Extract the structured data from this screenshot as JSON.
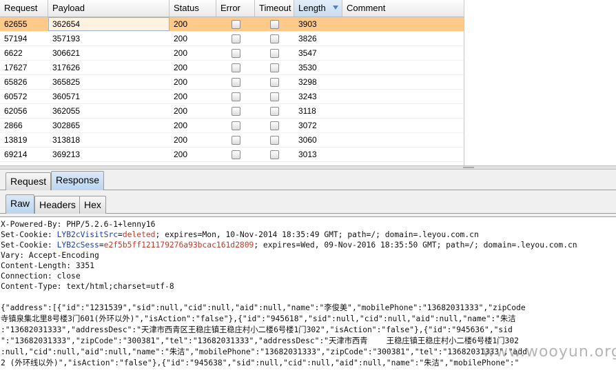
{
  "table": {
    "columns": [
      "Request",
      "Payload",
      "Status",
      "Error",
      "Timeout",
      "Length",
      "Comment"
    ],
    "rows": [
      {
        "request": "62655",
        "payload": "362654",
        "status": "200",
        "length": "3903"
      },
      {
        "request": "57194",
        "payload": "357193",
        "status": "200",
        "length": "3826"
      },
      {
        "request": "6622",
        "payload": "306621",
        "status": "200",
        "length": "3547"
      },
      {
        "request": "17627",
        "payload": "317626",
        "status": "200",
        "length": "3530"
      },
      {
        "request": "65826",
        "payload": "365825",
        "status": "200",
        "length": "3298"
      },
      {
        "request": "60572",
        "payload": "360571",
        "status": "200",
        "length": "3243"
      },
      {
        "request": "62056",
        "payload": "362055",
        "status": "200",
        "length": "3118"
      },
      {
        "request": "2866",
        "payload": "302865",
        "status": "200",
        "length": "3072"
      },
      {
        "request": "13819",
        "payload": "313818",
        "status": "200",
        "length": "3060"
      },
      {
        "request": "69214",
        "payload": "369213",
        "status": "200",
        "length": "3013"
      }
    ]
  },
  "tabs": {
    "outer": [
      "Request",
      "Response"
    ],
    "inner": [
      "Raw",
      "Headers",
      "Hex"
    ]
  },
  "response": {
    "headers": [
      "X-Powered-By: PHP/5.2.6-1+lenny16",
      "Vary: Accept-Encoding",
      "Content-Length: 3351",
      "Connection: close",
      "Content-Type: text/html;charset=utf-8"
    ],
    "cookie1": {
      "prefix": "Set-Cookie: ",
      "name": "LYB2cVisitSrc",
      "eq": "=",
      "value": "deleted",
      "rest": "; expires=Mon, 10-Nov-2014 18:35:49 GMT; path=/; domain=.leyou.com.cn"
    },
    "cookie2": {
      "prefix": "Set-Cookie: ",
      "name": "LYB2cSess",
      "eq": "=",
      "value": "e2f5b5ff121179276a93bcac161d2809",
      "rest": "; expires=Wed, 09-Nov-2016 18:35:50 GMT; path=/; domain=.leyou.com.cn"
    },
    "body": [
      "{\"address\":[{\"id\":\"1231539\",\"sid\":null,\"cid\":null,\"aid\":null,\"name\":\"李俊美\",\"mobilePhone\":\"13682031333\",\"zipCode",
      "寺镇泉集北里8号楼3门601(外环以外)\",\"isAction\":\"false\"},{\"id\":\"945618\",\"sid\":null,\"cid\":null,\"aid\":null,\"name\":\"朱洁",
      ":\"13682031333\",\"addressDesc\":\"天津市西青区王稳庄镇王稳庄村小二楼6号楼1门302\",\"isAction\":\"false\"},{\"id\":\"945636\",\"sid",
      "\":\"13682031333\",\"zipCode\":\"300381\",\"tel\":\"13682031333\",\"addressDesc\":\"天津市西青    王稳庄镇王稳庄村小二楼6号楼1门302",
      ":null,\"cid\":null,\"aid\":null,\"name\":\"朱洁\",\"mobilePhone\":\"13682031333\",\"zipCode\":\"300381\",\"tel\":\"13682031333\",\"add",
      "2 (外环线以外)\",\"isAction\":\"false\"},{\"id\":\"945638\",\"sid\":null,\"cid\":null,\"aid\":null,\"name\":\"朱洁\",\"mobilePhone\":\""
    ],
    "watermark": "www.wooyun.org"
  }
}
